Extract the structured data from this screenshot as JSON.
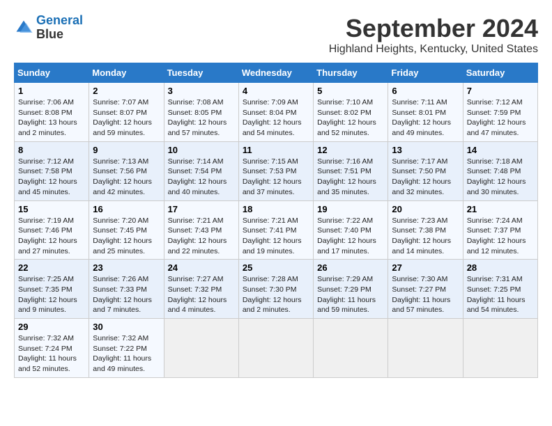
{
  "app": {
    "name": "GeneralBlue",
    "logo_text_line1": "General",
    "logo_text_line2": "Blue"
  },
  "calendar": {
    "month_year": "September 2024",
    "location": "Highland Heights, Kentucky, United States",
    "headers": [
      "Sunday",
      "Monday",
      "Tuesday",
      "Wednesday",
      "Thursday",
      "Friday",
      "Saturday"
    ],
    "weeks": [
      [
        null,
        {
          "day": "2",
          "sunrise": "Sunrise: 7:07 AM",
          "sunset": "Sunset: 8:07 PM",
          "daylight": "Daylight: 12 hours and 59 minutes."
        },
        {
          "day": "3",
          "sunrise": "Sunrise: 7:08 AM",
          "sunset": "Sunset: 8:05 PM",
          "daylight": "Daylight: 12 hours and 57 minutes."
        },
        {
          "day": "4",
          "sunrise": "Sunrise: 7:09 AM",
          "sunset": "Sunset: 8:04 PM",
          "daylight": "Daylight: 12 hours and 54 minutes."
        },
        {
          "day": "5",
          "sunrise": "Sunrise: 7:10 AM",
          "sunset": "Sunset: 8:02 PM",
          "daylight": "Daylight: 12 hours and 52 minutes."
        },
        {
          "day": "6",
          "sunrise": "Sunrise: 7:11 AM",
          "sunset": "Sunset: 8:01 PM",
          "daylight": "Daylight: 12 hours and 49 minutes."
        },
        {
          "day": "7",
          "sunrise": "Sunrise: 7:12 AM",
          "sunset": "Sunset: 7:59 PM",
          "daylight": "Daylight: 12 hours and 47 minutes."
        }
      ],
      [
        {
          "day": "1",
          "sunrise": "Sunrise: 7:06 AM",
          "sunset": "Sunset: 8:08 PM",
          "daylight": "Daylight: 13 hours and 2 minutes."
        },
        {
          "day": "9",
          "sunrise": "Sunrise: 7:13 AM",
          "sunset": "Sunset: 7:56 PM",
          "daylight": "Daylight: 12 hours and 42 minutes."
        },
        {
          "day": "10",
          "sunrise": "Sunrise: 7:14 AM",
          "sunset": "Sunset: 7:54 PM",
          "daylight": "Daylight: 12 hours and 40 minutes."
        },
        {
          "day": "11",
          "sunrise": "Sunrise: 7:15 AM",
          "sunset": "Sunset: 7:53 PM",
          "daylight": "Daylight: 12 hours and 37 minutes."
        },
        {
          "day": "12",
          "sunrise": "Sunrise: 7:16 AM",
          "sunset": "Sunset: 7:51 PM",
          "daylight": "Daylight: 12 hours and 35 minutes."
        },
        {
          "day": "13",
          "sunrise": "Sunrise: 7:17 AM",
          "sunset": "Sunset: 7:50 PM",
          "daylight": "Daylight: 12 hours and 32 minutes."
        },
        {
          "day": "14",
          "sunrise": "Sunrise: 7:18 AM",
          "sunset": "Sunset: 7:48 PM",
          "daylight": "Daylight: 12 hours and 30 minutes."
        }
      ],
      [
        {
          "day": "8",
          "sunrise": "Sunrise: 7:12 AM",
          "sunset": "Sunset: 7:58 PM",
          "daylight": "Daylight: 12 hours and 45 minutes."
        },
        {
          "day": "16",
          "sunrise": "Sunrise: 7:20 AM",
          "sunset": "Sunset: 7:45 PM",
          "daylight": "Daylight: 12 hours and 25 minutes."
        },
        {
          "day": "17",
          "sunrise": "Sunrise: 7:21 AM",
          "sunset": "Sunset: 7:43 PM",
          "daylight": "Daylight: 12 hours and 22 minutes."
        },
        {
          "day": "18",
          "sunrise": "Sunrise: 7:21 AM",
          "sunset": "Sunset: 7:41 PM",
          "daylight": "Daylight: 12 hours and 19 minutes."
        },
        {
          "day": "19",
          "sunrise": "Sunrise: 7:22 AM",
          "sunset": "Sunset: 7:40 PM",
          "daylight": "Daylight: 12 hours and 17 minutes."
        },
        {
          "day": "20",
          "sunrise": "Sunrise: 7:23 AM",
          "sunset": "Sunset: 7:38 PM",
          "daylight": "Daylight: 12 hours and 14 minutes."
        },
        {
          "day": "21",
          "sunrise": "Sunrise: 7:24 AM",
          "sunset": "Sunset: 7:37 PM",
          "daylight": "Daylight: 12 hours and 12 minutes."
        }
      ],
      [
        {
          "day": "15",
          "sunrise": "Sunrise: 7:19 AM",
          "sunset": "Sunset: 7:46 PM",
          "daylight": "Daylight: 12 hours and 27 minutes."
        },
        {
          "day": "23",
          "sunrise": "Sunrise: 7:26 AM",
          "sunset": "Sunset: 7:33 PM",
          "daylight": "Daylight: 12 hours and 7 minutes."
        },
        {
          "day": "24",
          "sunrise": "Sunrise: 7:27 AM",
          "sunset": "Sunset: 7:32 PM",
          "daylight": "Daylight: 12 hours and 4 minutes."
        },
        {
          "day": "25",
          "sunrise": "Sunrise: 7:28 AM",
          "sunset": "Sunset: 7:30 PM",
          "daylight": "Daylight: 12 hours and 2 minutes."
        },
        {
          "day": "26",
          "sunrise": "Sunrise: 7:29 AM",
          "sunset": "Sunset: 7:29 PM",
          "daylight": "Daylight: 11 hours and 59 minutes."
        },
        {
          "day": "27",
          "sunrise": "Sunrise: 7:30 AM",
          "sunset": "Sunset: 7:27 PM",
          "daylight": "Daylight: 11 hours and 57 minutes."
        },
        {
          "day": "28",
          "sunrise": "Sunrise: 7:31 AM",
          "sunset": "Sunset: 7:25 PM",
          "daylight": "Daylight: 11 hours and 54 minutes."
        }
      ],
      [
        {
          "day": "22",
          "sunrise": "Sunrise: 7:25 AM",
          "sunset": "Sunset: 7:35 PM",
          "daylight": "Daylight: 12 hours and 9 minutes."
        },
        {
          "day": "30",
          "sunrise": "Sunrise: 7:32 AM",
          "sunset": "Sunset: 7:22 PM",
          "daylight": "Daylight: 11 hours and 49 minutes."
        },
        null,
        null,
        null,
        null,
        null
      ],
      [
        {
          "day": "29",
          "sunrise": "Sunrise: 7:32 AM",
          "sunset": "Sunset: 7:24 PM",
          "daylight": "Daylight: 11 hours and 52 minutes."
        },
        null,
        null,
        null,
        null,
        null,
        null
      ]
    ]
  }
}
